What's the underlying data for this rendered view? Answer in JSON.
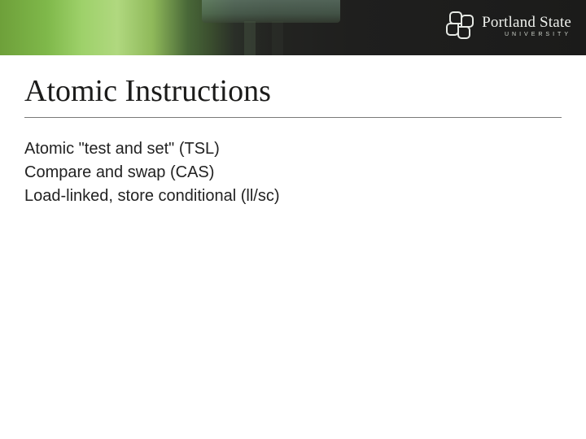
{
  "brand": {
    "name": "Portland State",
    "subline": "UNIVERSITY"
  },
  "slide": {
    "title": "Atomic Instructions",
    "lines": [
      "Atomic \"test and set\" (TSL)",
      "Compare and swap (CAS)",
      "Load-linked, store conditional (ll/sc)"
    ]
  }
}
